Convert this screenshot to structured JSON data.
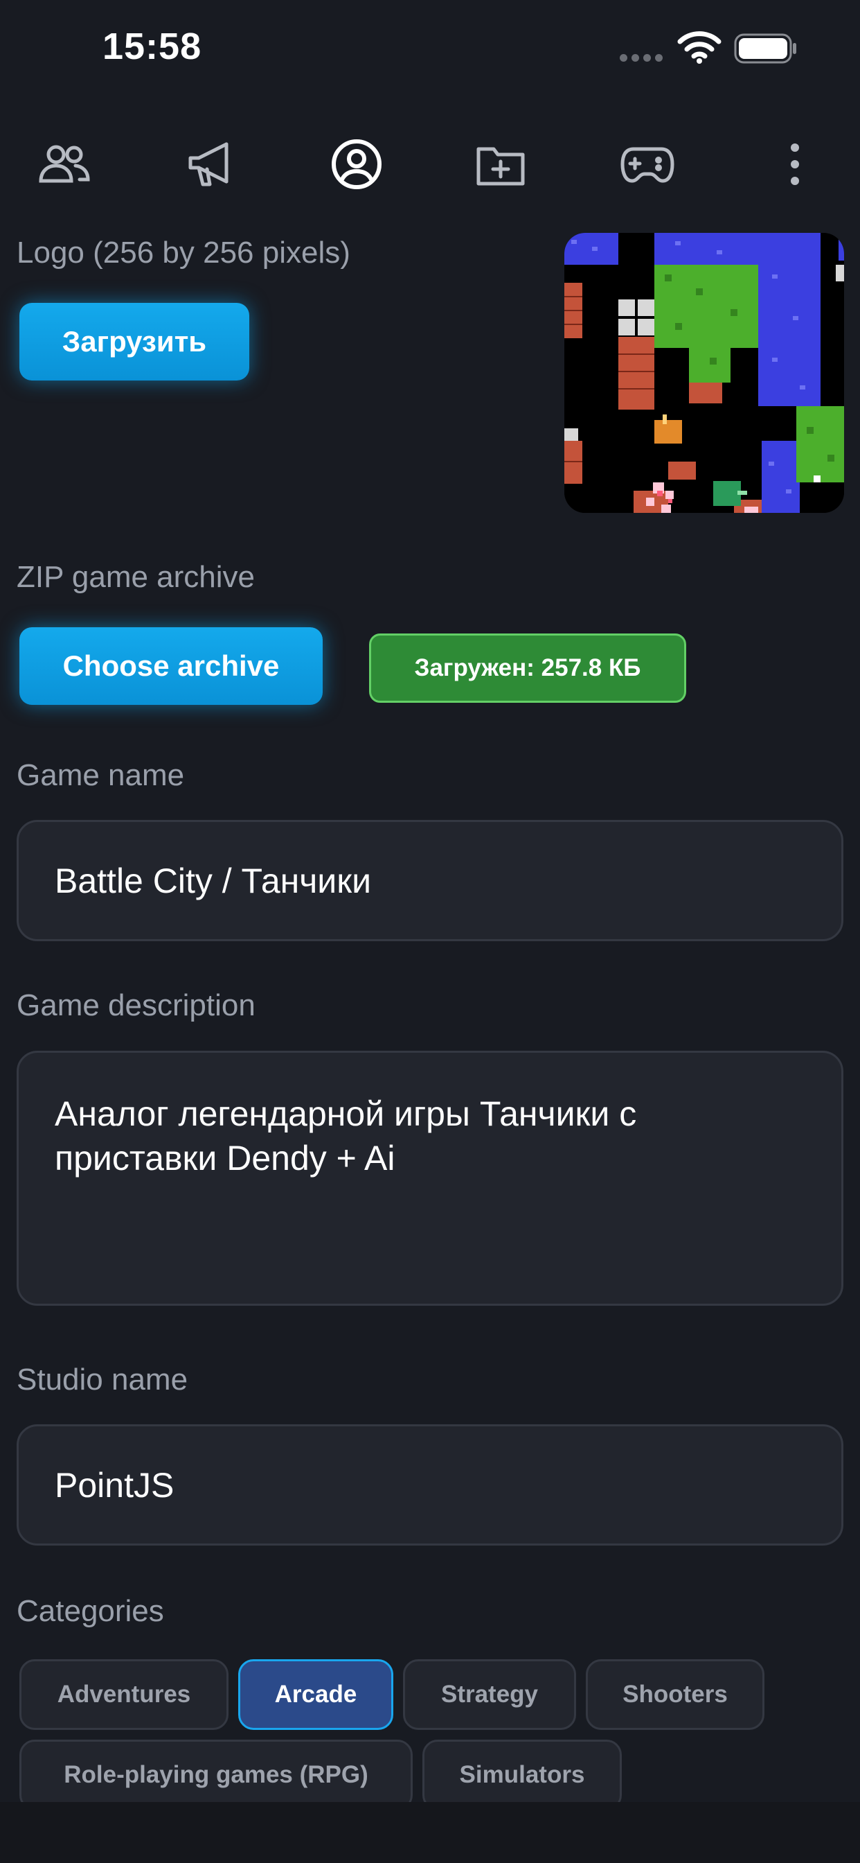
{
  "status_bar": {
    "time": "15:58"
  },
  "nav": {
    "items": [
      {
        "icon": "users-icon"
      },
      {
        "icon": "megaphone-icon"
      },
      {
        "icon": "user-circle-icon",
        "active": true
      },
      {
        "icon": "folder-plus-icon"
      },
      {
        "icon": "gamepad-icon"
      },
      {
        "icon": "more-vertical-icon"
      }
    ]
  },
  "logo_section": {
    "label": "Logo (256 by 256 pixels)",
    "upload_button": "Загрузить"
  },
  "archive_section": {
    "label": "ZIP game archive",
    "choose_button": "Choose archive",
    "status_badge": "Загружен: 257.8 КБ"
  },
  "game_name": {
    "label": "Game name",
    "value": "Battle City / Танчики"
  },
  "game_description": {
    "label": "Game description",
    "value": "Аналог легендарной игры Танчики с приставки Dendy + Ai"
  },
  "studio_name": {
    "label": "Studio name",
    "value": "PointJS"
  },
  "categories": {
    "label": "Categories",
    "items": [
      {
        "label": "Adventures",
        "selected": false
      },
      {
        "label": "Arcade",
        "selected": true
      },
      {
        "label": "Strategy",
        "selected": false
      },
      {
        "label": "Shooters",
        "selected": false
      },
      {
        "label": "Role-playing games (RPG)",
        "selected": false
      },
      {
        "label": "Simulators",
        "selected": false
      }
    ]
  },
  "colors": {
    "background": "#181b22",
    "accent_blue": "#0f9fe4",
    "success_green": "#2e8b36",
    "chip_active": "#2b4a8a"
  }
}
